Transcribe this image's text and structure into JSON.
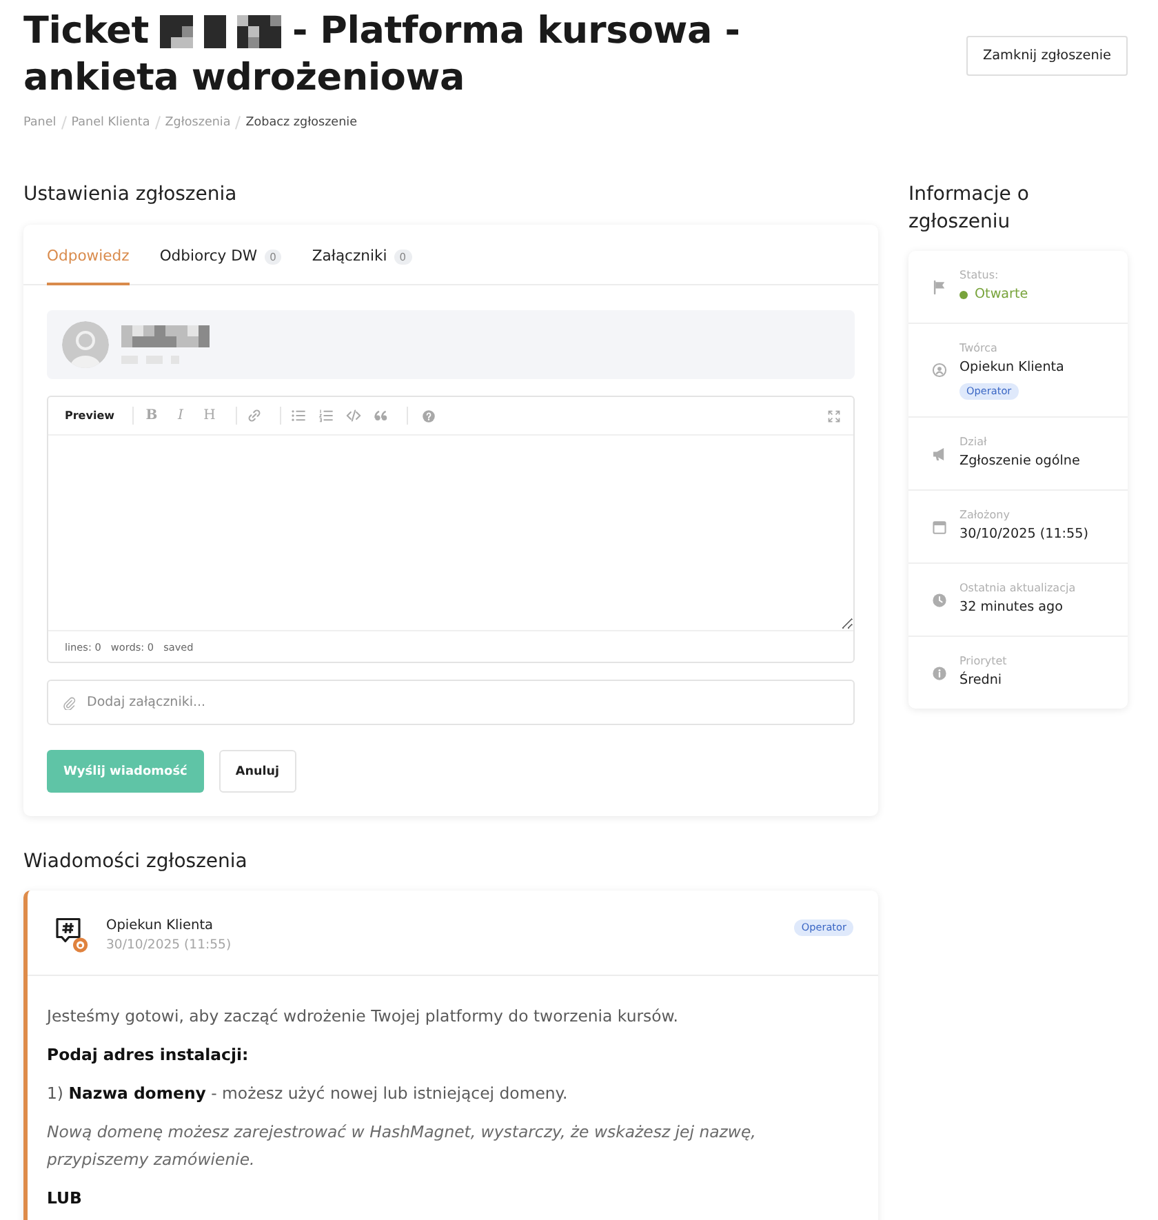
{
  "page": {
    "title_parts": [
      "Ticket",
      "- Platforma kursowa -",
      "ankieta wdrożeniowa"
    ],
    "close_button": "Zamknij zgłoszenie"
  },
  "breadcrumb": [
    {
      "label": "Panel",
      "current": false
    },
    {
      "label": "Panel Klienta",
      "current": false
    },
    {
      "label": "Zgłoszenia",
      "current": false
    },
    {
      "label": "Zobacz zgłoszenie",
      "current": true
    }
  ],
  "reply_section": {
    "heading": "Ustawienia zgłoszenia",
    "tabs": [
      {
        "label": "Odpowiedz",
        "selected": true
      },
      {
        "label": "Odbiorcy DW",
        "count": "0",
        "selected": false
      },
      {
        "label": "Załączniki",
        "count": "0",
        "selected": false
      }
    ],
    "editor": {
      "preview_button": "Preview",
      "format_buttons": [
        "B",
        "I",
        "H"
      ],
      "status": [
        "lines: 0",
        "words: 0",
        "saved"
      ]
    },
    "attachment_field": {
      "placeholder": "Dodaj załączniki..."
    },
    "buttons": [
      {
        "label": "Wyślij wiadomość",
        "kind": "primary"
      },
      {
        "label": "Anuluj",
        "kind": "secondary"
      }
    ]
  },
  "info_panel": {
    "heading": "Informacje o zgłoszeniu",
    "rows": [
      {
        "kind": "status",
        "label": "Status:",
        "value": "Otwarte",
        "color": "#78a33b"
      },
      {
        "kind": "user",
        "label": "Twórca",
        "value": "Opiekun Klienta",
        "badge": "Operator"
      },
      {
        "kind": "plain",
        "label": "Dział",
        "value": "Zgłoszenie ogólne"
      },
      {
        "kind": "plain",
        "label": "Założony",
        "value": "30/10/2025 (11:55)"
      },
      {
        "kind": "plain",
        "label": "Ostatnia aktualizacja",
        "value": "32 minutes ago"
      },
      {
        "kind": "plain",
        "label": "Priorytet",
        "value": "Średni"
      }
    ]
  },
  "messages": {
    "heading": "Wiadomości zgłoszenia",
    "items": [
      {
        "author": "Opiekun Klienta",
        "date": "30/10/2025 (11:55)",
        "badge": "Operator",
        "paragraphs": [
          {
            "kind": "text",
            "text": "Jesteśmy gotowi, aby zacząć wdrożenie Twojej platformy do tworzenia kursów."
          },
          {
            "kind": "bold",
            "text": "Podaj adres instalacji:"
          },
          {
            "kind": "text",
            "text": "1) **Nazwa domeny** - możesz użyć nowej lub istniejącej domeny."
          },
          {
            "kind": "italic",
            "text": "Nową domenę możesz zarejestrować w HashMagnet, wystarczy, że wskażesz jej nazwę, przypiszemy zamówienie."
          },
          {
            "kind": "bold",
            "text": "LUB"
          }
        ]
      }
    ]
  }
}
